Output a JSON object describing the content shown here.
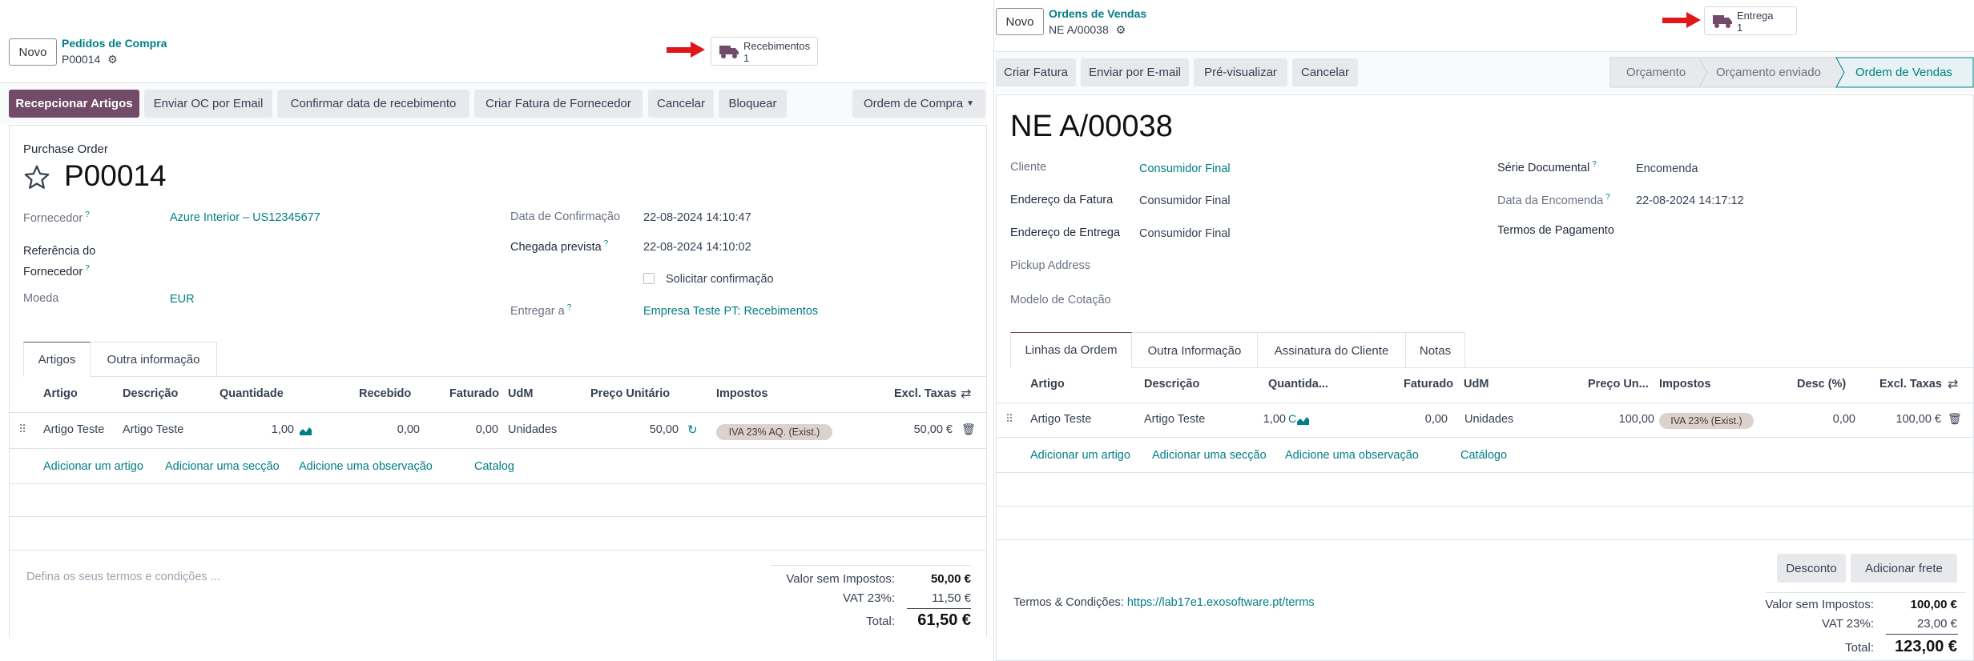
{
  "left": {
    "new_button": "Novo",
    "breadcrumb_parent": "Pedidos de Compra",
    "breadcrumb_current": "P00014",
    "smart_button": {
      "label": "Recebimentos",
      "count": "1"
    },
    "actions": [
      "Recepcionar Artigos",
      "Enviar OC por Email",
      "Confirmar data de recebimento",
      "Criar Fatura de Fornecedor",
      "Cancelar",
      "Bloquear"
    ],
    "dropdown_label": "Ordem de Compra",
    "form_subtitle": "Purchase Order",
    "form_title": "P00014",
    "fields": {
      "fornecedor_label": "Fornecedor",
      "fornecedor_value": "Azure Interior – US12345677",
      "referencia_label_1": "Referência do",
      "referencia_label_2": "Fornecedor",
      "moeda_label": "Moeda",
      "moeda_value": "EUR",
      "data_confirmacao_label": "Data de Confirmação",
      "data_confirmacao_value": "22-08-2024 14:10:47",
      "chegada_label": "Chegada prevista",
      "chegada_value": "22-08-2024 14:10:02",
      "solicitar_label": "Solicitar confirmação",
      "entregar_label": "Entregar a",
      "entregar_value": "Empresa Teste PT: Recebimentos"
    },
    "tabs": [
      "Artigos",
      "Outra informação"
    ],
    "table": {
      "headers": [
        "Artigo",
        "Descrição",
        "Quantidade",
        "Recebido",
        "Faturado",
        "UdM",
        "Preço Unitário",
        "Impostos",
        "Excl. Taxas"
      ],
      "row": {
        "artigo": "Artigo Teste",
        "descricao": "Artigo Teste",
        "quantidade": "1,00",
        "recebido": "0,00",
        "faturado": "0,00",
        "udm": "Unidades",
        "preco": "50,00",
        "imposto": "IVA 23% AQ. (Exist.)",
        "excl": "50,00 €"
      },
      "add_links": [
        "Adicionar um artigo",
        "Adicionar uma secção",
        "Adicione uma observação",
        "Catalog"
      ]
    },
    "terms_placeholder": "Defina os seus termos e condições ...",
    "totals": {
      "sem_impostos_label": "Valor sem Impostos:",
      "sem_impostos_value": "50,00 €",
      "vat_label": "VAT 23%:",
      "vat_value": "11,50 €",
      "total_label": "Total:",
      "total_value": "61,50 €"
    }
  },
  "right": {
    "new_button": "Novo",
    "breadcrumb_parent": "Ordens de Vendas",
    "breadcrumb_current": "NE A/00038",
    "smart_button": {
      "label": "Entrega",
      "count": "1"
    },
    "actions": [
      "Criar Fatura",
      "Enviar por E-mail",
      "Pré-visualizar",
      "Cancelar"
    ],
    "stages": [
      "Orçamento",
      "Orçamento enviado",
      "Ordem de Vendas"
    ],
    "form_title": "NE A/00038",
    "fields": {
      "cliente_label": "Cliente",
      "cliente_value": "Consumidor Final",
      "end_fatura_label": "Endereço da Fatura",
      "end_fatura_value": "Consumidor Final",
      "end_entrega_label": "Endereço de Entrega",
      "end_entrega_value": "Consumidor Final",
      "pickup_label": "Pickup Address",
      "modelo_label": "Modelo de Cotação",
      "serie_label": "Série Documental",
      "serie_value": "Encomenda",
      "data_encomenda_label": "Data da Encomenda",
      "data_encomenda_value": "22-08-2024 14:17:12",
      "termos_label": "Termos de Pagamento"
    },
    "tabs": [
      "Linhas da Ordem",
      "Outra Informação",
      "Assinatura do Cliente",
      "Notas"
    ],
    "table": {
      "headers": [
        "Artigo",
        "Descrição",
        "Quantida...",
        "Faturado",
        "UdM",
        "Preço Un...",
        "Impostos",
        "Desc (%)",
        "Excl. Taxas"
      ],
      "row": {
        "artigo": "Artigo Teste",
        "descricao": "Artigo Teste",
        "quantidade": "1,00",
        "faturado": "0,00",
        "udm": "Unidades",
        "preco": "100,00",
        "imposto": "IVA 23% (Exist.)",
        "desc": "0,00",
        "excl": "100,00 €"
      },
      "add_links": [
        "Adicionar um artigo",
        "Adicionar uma secção",
        "Adicione uma observação",
        "Catálogo"
      ]
    },
    "desconto_button": "Desconto",
    "frete_button": "Adicionar frete",
    "terms_label": "Termos & Condições:",
    "terms_link": "https://lab17e1.exosoftware.pt/terms",
    "totals": {
      "sem_impostos_label": "Valor sem Impostos:",
      "sem_impostos_value": "100,00 €",
      "vat_label": "VAT 23%:",
      "vat_value": "23,00 €",
      "total_label": "Total:",
      "total_value": "123,00 €"
    }
  },
  "colors": {
    "primary": "#714b67",
    "link": "#017e84",
    "arrow": "#e0161a"
  }
}
